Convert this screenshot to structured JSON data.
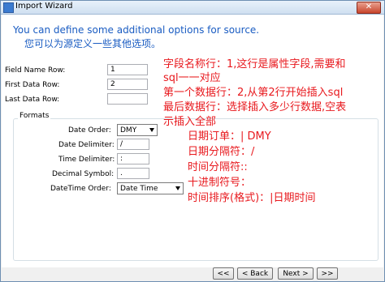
{
  "window": {
    "title": "Import Wizard",
    "close": "✕"
  },
  "header": {
    "heading": "You can define some additional options for source.",
    "heading_cn": "您可以为源定义一些其他选项。"
  },
  "fields": {
    "field_name_row": {
      "label": "Field Name Row:",
      "value": "1"
    },
    "first_data_row": {
      "label": "First Data Row:",
      "value": "2"
    },
    "last_data_row": {
      "label": "Last Data Row:",
      "value": ""
    }
  },
  "formats": {
    "title": "Formats",
    "date_order": {
      "label": "Date Order:",
      "value": "DMY"
    },
    "date_delimiter": {
      "label": "Date Delimiter:",
      "value": "/"
    },
    "time_delimiter": {
      "label": "Time Delimiter:",
      "value": ":"
    },
    "decimal_symbol": {
      "label": "Decimal Symbol:",
      "value": "."
    },
    "datetime_order": {
      "label": "DateTime Order:",
      "value": "Date Time"
    }
  },
  "annotations": {
    "line1": "字段名称行：1,这行是属性字段,需要和",
    "line2": "sql一一对应",
    "line3": "第一个数据行：2,从第2行开始插入sql",
    "line4": "最后数据行：选择插入多少行数据,空表",
    "line5": "示插入全部",
    "line6": "日期订单：| DMY",
    "line7": "日期分隔符：/",
    "line8": "时间分隔符::",
    "line9": "十进制符号：",
    "line10": "时间排序(格式)：|日期时间"
  },
  "buttons": {
    "first": "<<",
    "back": "< Back",
    "next": "Next >",
    "last": ">>"
  },
  "colors": {
    "heading": "#1a5cc2",
    "annotation": "#e8191e"
  }
}
